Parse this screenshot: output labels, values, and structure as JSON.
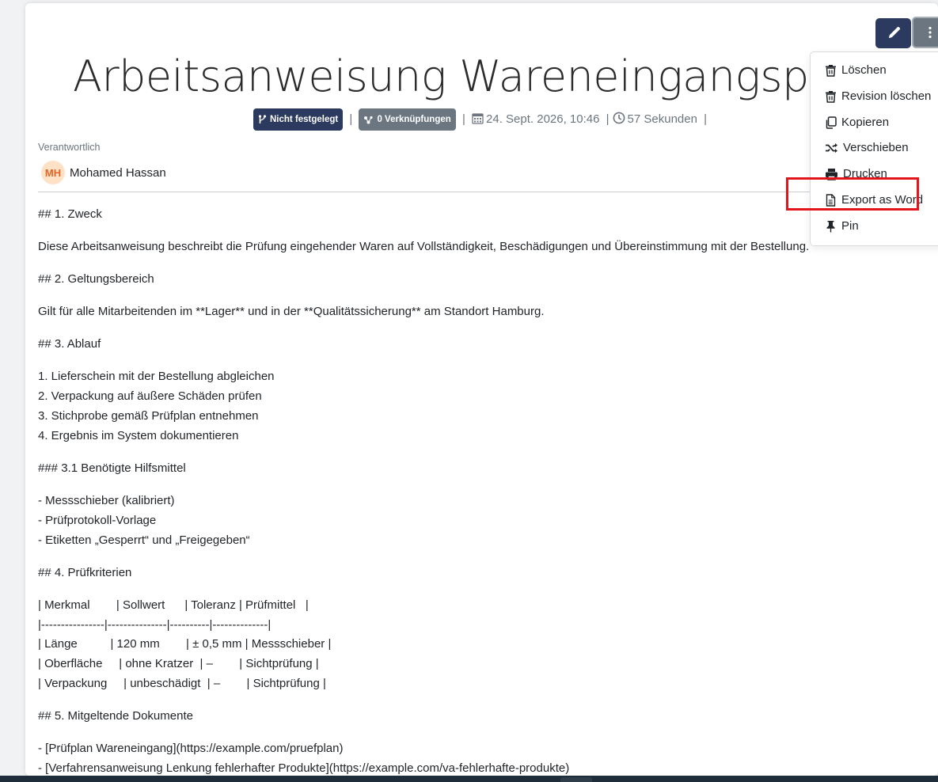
{
  "document": {
    "title": "Arbeitsanweisung Wareneingangsprüfung",
    "meta": {
      "branch_badge": "Nicht festgelegt",
      "links_badge": "0 Verknüpfungen",
      "date": "24. Sept. 2026, 10:46",
      "duration": "57 Sekunden",
      "separator": "|"
    },
    "responsible": {
      "label": "Verantwortlich",
      "initials": "MH",
      "name": "Mohamed Hassan"
    },
    "content_lines": [
      "## 1. Zweck",
      "Diese Arbeitsanweisung beschreibt die Prüfung eingehender Waren auf Vollständigkeit, Beschädigungen und Übereinstimmung mit der Bestellung.",
      "## 2. Geltungsbereich",
      "Gilt für alle Mitarbeitenden im **Lager** und in der **Qualitätssicherung** am Standort Hamburg.",
      "## 3. Ablauf",
      "1. Lieferschein mit der Bestellung abgleichen\n2. Verpackung auf äußere Schäden prüfen\n3. Stichprobe gemäß Prüfplan entnehmen\n4. Ergebnis im System dokumentieren",
      "### 3.1 Benötigte Hilfsmittel",
      "- Messschieber (kalibriert)\n- Prüfprotokoll-Vorlage\n- Etiketten „Gesperrt“ und „Freigegeben“",
      "## 4. Prüfkriterien",
      "| Merkmal        | Sollwert      | Toleranz | Prüfmittel   |\n|----------------|---------------|----------|--------------|\n| Länge          | 120 mm        | ± 0,5 mm | Messschieber |\n| Oberfläche     | ohne Kratzer  | –        | Sichtprüfung |\n| Verpackung     | unbeschädigt  | –        | Sichtprüfung |",
      "## 5. Mitgeltende Dokumente",
      "- [Prüfplan Wareneingang](https://example.com/pruefplan)\n- [Verfahrensanweisung Lenkung fehlerhafter Produkte](https://example.com/va-fehlerhafte-produkte)"
    ]
  },
  "menu": {
    "items": [
      {
        "label": "Löschen",
        "icon": "trash-icon"
      },
      {
        "label": "Revision löschen",
        "icon": "trash-icon"
      },
      {
        "label": "Kopieren",
        "icon": "copy-icon"
      },
      {
        "label": "Verschieben",
        "icon": "shuffle-icon"
      },
      {
        "label": "Drucken",
        "icon": "printer-icon"
      },
      {
        "label": "Export as Word",
        "icon": "file-icon"
      },
      {
        "label": "Pin",
        "icon": "pin-icon"
      }
    ],
    "highlighted_item": "Export as Word"
  },
  "colors": {
    "primary": "#2b3a5e",
    "secondary": "#6b7681",
    "avatar_bg": "#ffe1c6",
    "avatar_text": "#e0662a",
    "highlight": "#e3151a"
  }
}
